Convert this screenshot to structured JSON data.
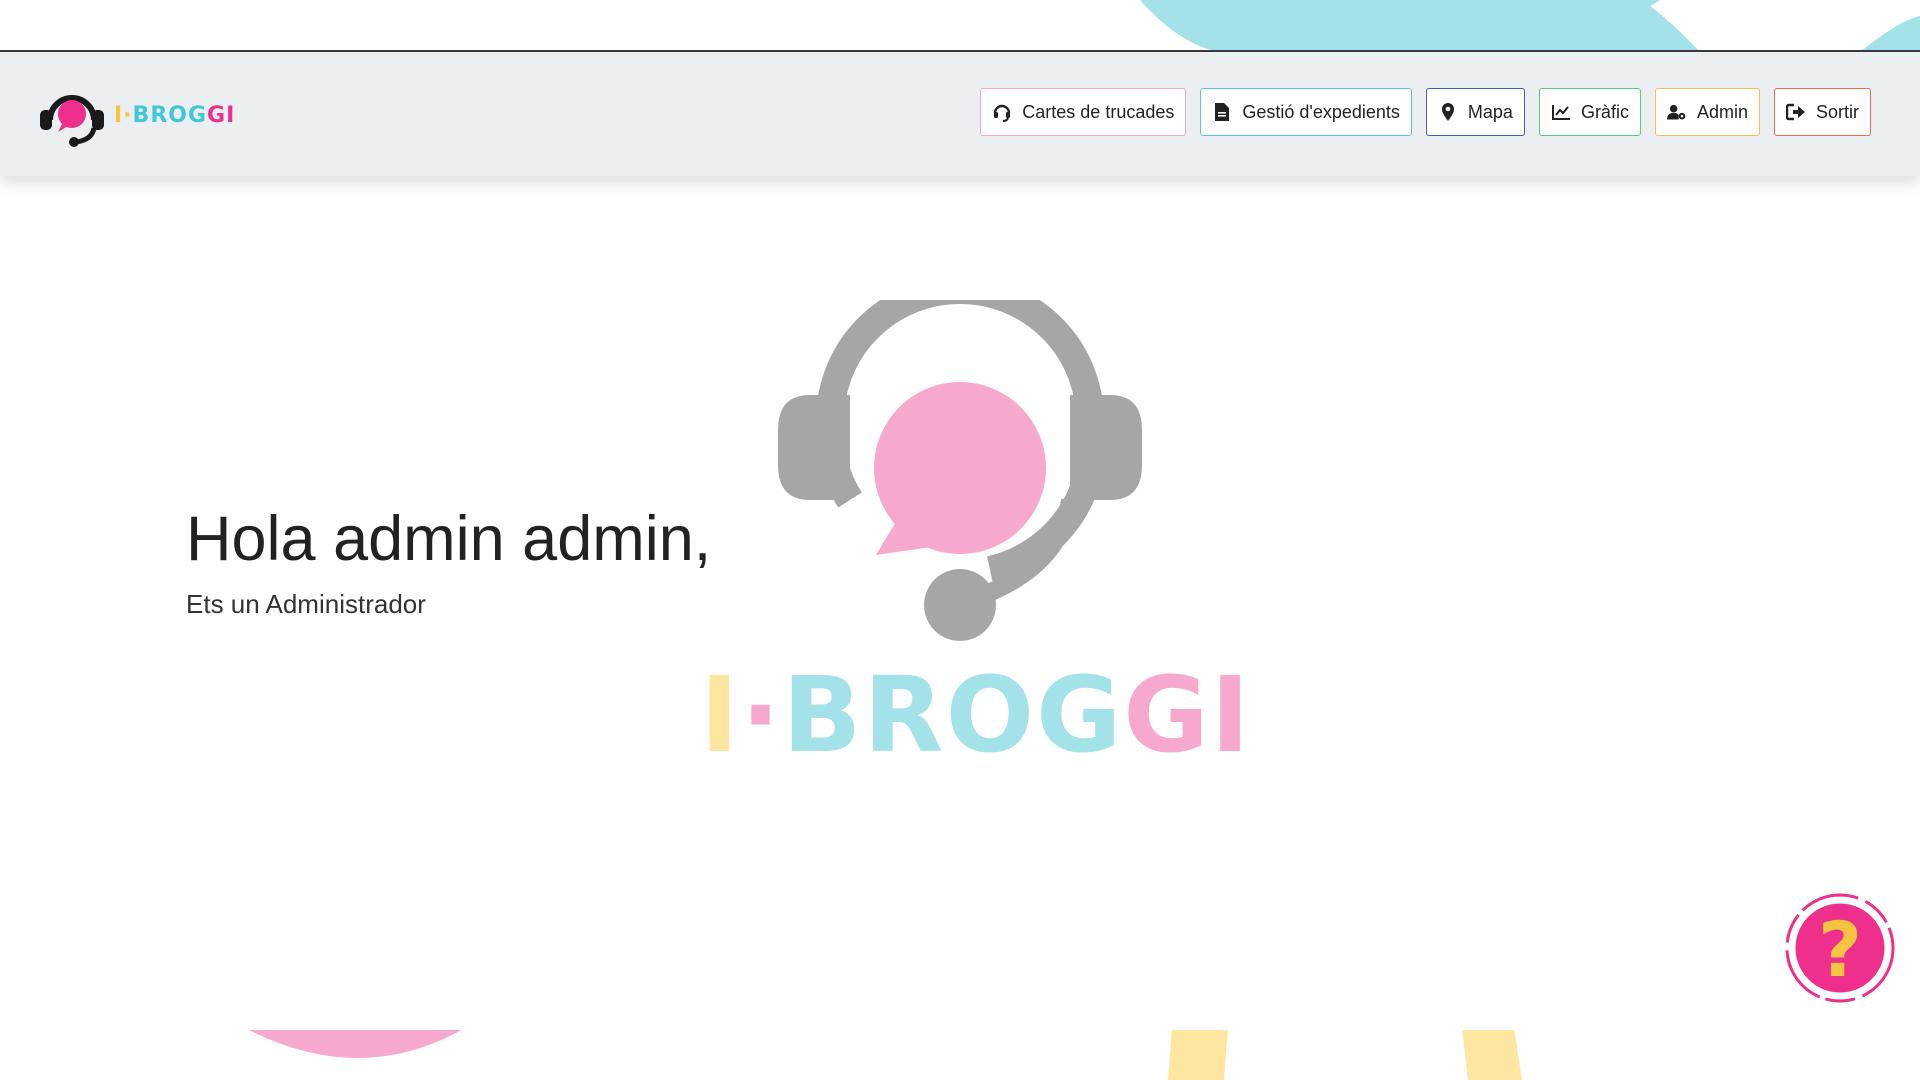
{
  "brand": {
    "prefix": "I·",
    "mid": "BROG",
    "suffix": "GI",
    "colors": {
      "yellow": "#f5c542",
      "cyan": "#3ec8d8",
      "pink": "#ee2f8c"
    }
  },
  "nav": {
    "items": [
      {
        "label": "Cartes de trucades",
        "icon": "headset-icon",
        "color": "#f3a7c1"
      },
      {
        "label": "Gestió d'expedients",
        "icon": "file-icon",
        "color": "#57c6dc"
      },
      {
        "label": "Mapa",
        "icon": "map-pin-icon",
        "color": "#4c56b5"
      },
      {
        "label": "Gràfic",
        "icon": "line-chart-icon",
        "color": "#5cc97a"
      },
      {
        "label": "Admin",
        "icon": "user-gear-icon",
        "color": "#f4bd55"
      },
      {
        "label": "Sortir",
        "icon": "sign-out-icon",
        "color": "#ee6a3d"
      }
    ]
  },
  "main": {
    "greeting": "Hola admin admin,",
    "role": "Ets un Administrador",
    "logo_text": {
      "i": "I",
      "dot": "·",
      "brog": "BROG",
      "gi": "GI"
    }
  },
  "help": {
    "icon": "question-icon",
    "label": "?"
  },
  "accent_colors": {
    "light_cyan": "#a4e2ea",
    "light_pink": "#f7a8cd",
    "light_yellow": "#fde7a0",
    "gray": "#a6a6a6"
  }
}
